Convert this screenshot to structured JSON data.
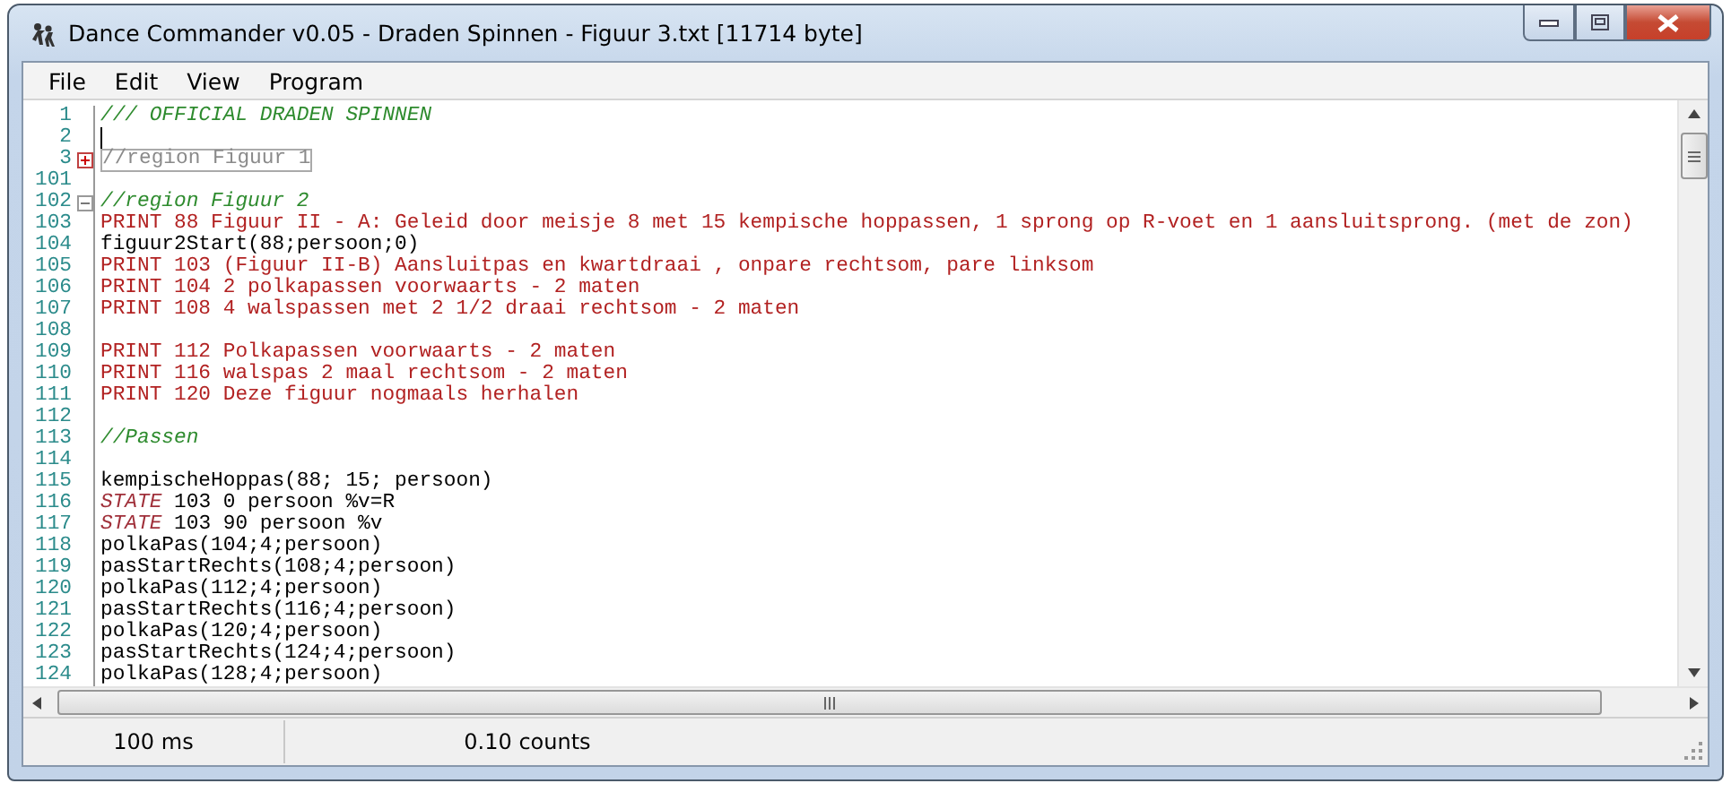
{
  "window": {
    "title": "Dance Commander v0.05 - Draden Spinnen - Figuur 3.txt [11714 byte]"
  },
  "menu": [
    "File",
    "Edit",
    "View",
    "Program"
  ],
  "editor": {
    "lines": [
      {
        "number": "1",
        "kind": "comment",
        "text": "/// OFFICIAL DRADEN SPINNEN"
      },
      {
        "number": "2",
        "kind": "blank"
      },
      {
        "number": "3",
        "kind": "region",
        "collapsed": true,
        "text": "//region Figuur 1"
      },
      {
        "number": "101",
        "kind": "blank"
      },
      {
        "number": "102",
        "kind": "region",
        "collapsed": false,
        "text": "//region Figuur 2"
      },
      {
        "number": "103",
        "kind": "print",
        "text": "PRINT 88 Figuur II - A: Geleid door meisje 8 met 15 kempische hoppassen, 1 sprong op R-voet en 1 aansluitsprong. (met de zon)"
      },
      {
        "number": "104",
        "kind": "code",
        "text": "figuur2Start(88;persoon;0)"
      },
      {
        "number": "105",
        "kind": "print",
        "text": "PRINT 103 (Figuur II-B) Aansluitpas en kwartdraai , onpare rechtsom, pare linksom"
      },
      {
        "number": "106",
        "kind": "print",
        "text": "PRINT 104 2 polkapassen voorwaarts - 2 maten"
      },
      {
        "number": "107",
        "kind": "print",
        "text": "PRINT 108 4 walspassen met 2 1/2 draai rechtsom - 2 maten"
      },
      {
        "number": "108",
        "kind": "blank"
      },
      {
        "number": "109",
        "kind": "print",
        "text": "PRINT 112 Polkapassen voorwaarts - 2 maten"
      },
      {
        "number": "110",
        "kind": "print",
        "text": "PRINT 116 walspas 2 maal rechtsom - 2 maten"
      },
      {
        "number": "111",
        "kind": "print",
        "text": "PRINT 120 Deze figuur nogmaals herhalen"
      },
      {
        "number": "112",
        "kind": "blank"
      },
      {
        "number": "113",
        "kind": "comment",
        "text": "//Passen"
      },
      {
        "number": "114",
        "kind": "blank"
      },
      {
        "number": "115",
        "kind": "code",
        "text": "kempischeHoppas(88; 15; persoon)"
      },
      {
        "number": "116",
        "kind": "state",
        "keyword": "STATE",
        "text": " 103 0 persoon %v=R"
      },
      {
        "number": "117",
        "kind": "state",
        "keyword": "STATE",
        "text": " 103 90 persoon %v"
      },
      {
        "number": "118",
        "kind": "code",
        "text": "polkaPas(104;4;persoon)"
      },
      {
        "number": "119",
        "kind": "code",
        "text": "pasStartRechts(108;4;persoon)"
      },
      {
        "number": "120",
        "kind": "code",
        "text": "polkaPas(112;4;persoon)"
      },
      {
        "number": "121",
        "kind": "code",
        "text": "pasStartRechts(116;4;persoon)"
      },
      {
        "number": "122",
        "kind": "code",
        "text": "polkaPas(120;4;persoon)"
      },
      {
        "number": "123",
        "kind": "code",
        "text": "pasStartRechts(124;4;persoon)"
      },
      {
        "number": "124",
        "kind": "code",
        "text": "polkaPas(128;4;persoon)"
      }
    ]
  },
  "status_bar": [
    "100 ms",
    "0.10 counts"
  ]
}
